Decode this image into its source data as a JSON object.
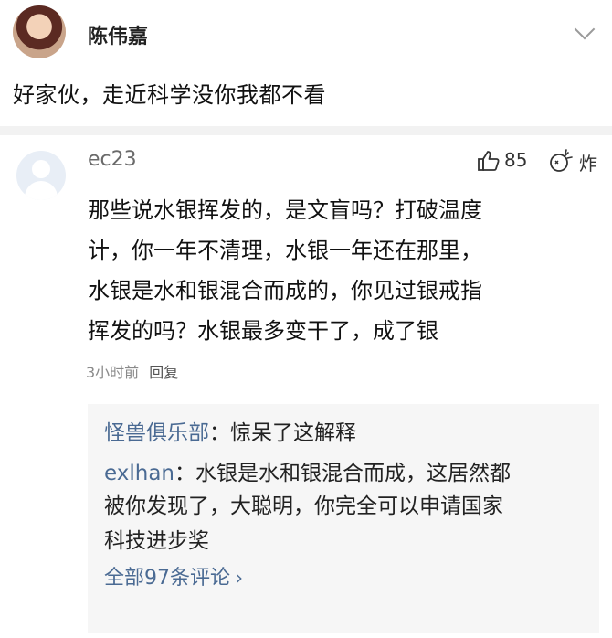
{
  "post": {
    "author": "陈伟嘉",
    "text": "好家伙，走近科学没你我都不看"
  },
  "comment": {
    "user": "ec23",
    "likes": "85",
    "boom_label": "炸",
    "lines": [
      "那些说水银挥发的，是文盲吗？打破温度",
      "计，你一年不清理，水银一年还在那里，",
      "水银是水和银混合而成的，你见过银戒指",
      "挥发的吗？水银最多变干了，成了银"
    ],
    "time": "3小时前",
    "reply_label": "回复"
  },
  "replies": {
    "items": [
      {
        "user": "怪兽俱乐部",
        "sep": "：",
        "text": "惊呆了这解释"
      },
      {
        "user": "exlhan",
        "sep": "：",
        "text": "水银是水和银混合而成，这居然都"
      }
    ],
    "continuation": [
      "被你发现了，大聪明，你完全可以申请国家",
      "科技进步奖"
    ],
    "view_all": "全部97条评论",
    "view_all_arrow": "›"
  },
  "colors": {
    "link": "#4a6a93",
    "divider": "#f2f2f2",
    "reply_bg": "#f6f6f6"
  },
  "icons": [
    "avatar",
    "chevron-down-icon",
    "thumbs-up-icon",
    "boom-icon",
    "default-avatar-icon"
  ]
}
